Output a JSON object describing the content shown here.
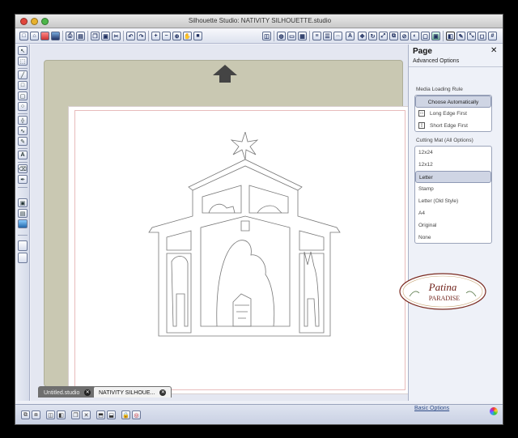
{
  "window": {
    "title": "Silhouette Studio: NATIVITY SILHOUETTE.studio"
  },
  "toolbar": {
    "icons": [
      "new-icon",
      "open-icon",
      "save-icon",
      "save-library-icon",
      "print-icon",
      "cut-settings-icon",
      "copy-icon",
      "paste-icon",
      "cut-icon",
      "undo-icon",
      "redo-icon",
      "zoom-in-icon",
      "zoom-out-icon",
      "zoom-fit-icon",
      "pan-icon",
      "fit-page-icon",
      "group-icon",
      "fill-icon",
      "line-icon",
      "shadow-icon",
      "align-icon",
      "replicate-icon",
      "transform-icon",
      "text-icon",
      "move-icon",
      "rotate-icon",
      "scale-icon",
      "layers-icon",
      "knife-icon",
      "trace-icon",
      "offset-icon",
      "page-icon",
      "cut-style-icon",
      "send-to-cutter-icon",
      "grid-icon"
    ]
  },
  "tabs": [
    {
      "label": "Untitled.studio",
      "active": false
    },
    {
      "label": "NATIVITY SILHOUE...",
      "active": true
    }
  ],
  "panel": {
    "title": "Page",
    "close": "✕",
    "subtitle": "Advanced Options",
    "media_label": "Media Loading Rule",
    "media_options": [
      {
        "label": "Choose Automatically",
        "selected": true,
        "icon": ""
      },
      {
        "label": "Long Edge First",
        "selected": false,
        "icon": "long-edge-icon"
      },
      {
        "label": "Short Edge First",
        "selected": false,
        "icon": "short-edge-icon"
      }
    ],
    "mat_label": "Cutting Mat (All Options)",
    "mat_options": [
      {
        "label": "12x24",
        "selected": false
      },
      {
        "label": "12x12",
        "selected": false
      },
      {
        "label": "Letter",
        "selected": true
      },
      {
        "label": "Stamp",
        "selected": false
      },
      {
        "label": "Letter (Old Style)",
        "selected": false
      },
      {
        "label": "A4",
        "selected": false
      },
      {
        "label": "Original",
        "selected": false
      },
      {
        "label": "None",
        "selected": false
      }
    ],
    "basic_link": "Basic Options"
  },
  "watermark": {
    "text_line1": "Patina",
    "text_line2": "PARADISE"
  },
  "colors": {
    "mat": "#c9c8b2",
    "panel_bg": "#eef1f8",
    "selected_option": "#cfd5e4"
  }
}
